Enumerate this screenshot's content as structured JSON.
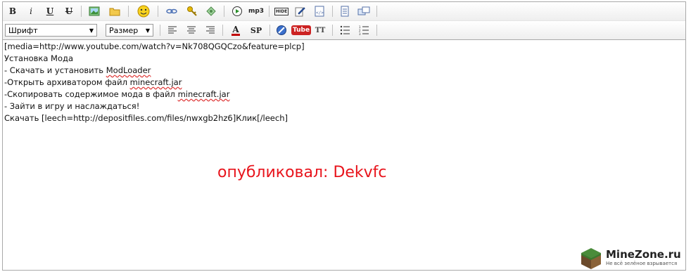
{
  "toolbar_row1": {
    "bold": "B",
    "italic": "i",
    "underline": "U",
    "strike": "U",
    "mp3": "mp3",
    "hide": "HIDE"
  },
  "toolbar_row2": {
    "font_select": "Шрифт",
    "size_select": "Размер",
    "color_a": "A",
    "sp": "SP",
    "youtube": "Tube",
    "tt": "TT"
  },
  "content": {
    "lines": [
      "[media=http://www.youtube.com/watch?v=Nk708QGQCzo&feature=plcp]",
      "Установка Мода",
      "- Скачать и установить ",
      "-Открыть архиватором файл ",
      "-Скопировать содержимое мода в файл ",
      "- Зайти в игру и наслаждаться!",
      "Скачать [leech=http://depositfiles.com/files/nwxgb2hz6]Клик[/leech]"
    ],
    "misspelled": [
      "ModLoader",
      "minecraft.jar",
      "minecraft.jar"
    ]
  },
  "overlay_text": "опубликовал: Dekvfc",
  "logo": {
    "name": "MineZone.ru",
    "tagline": "Не всё зелёное взрывается"
  },
  "colors": {
    "overlay": "#e8141c",
    "youtube": "#cc2222"
  }
}
